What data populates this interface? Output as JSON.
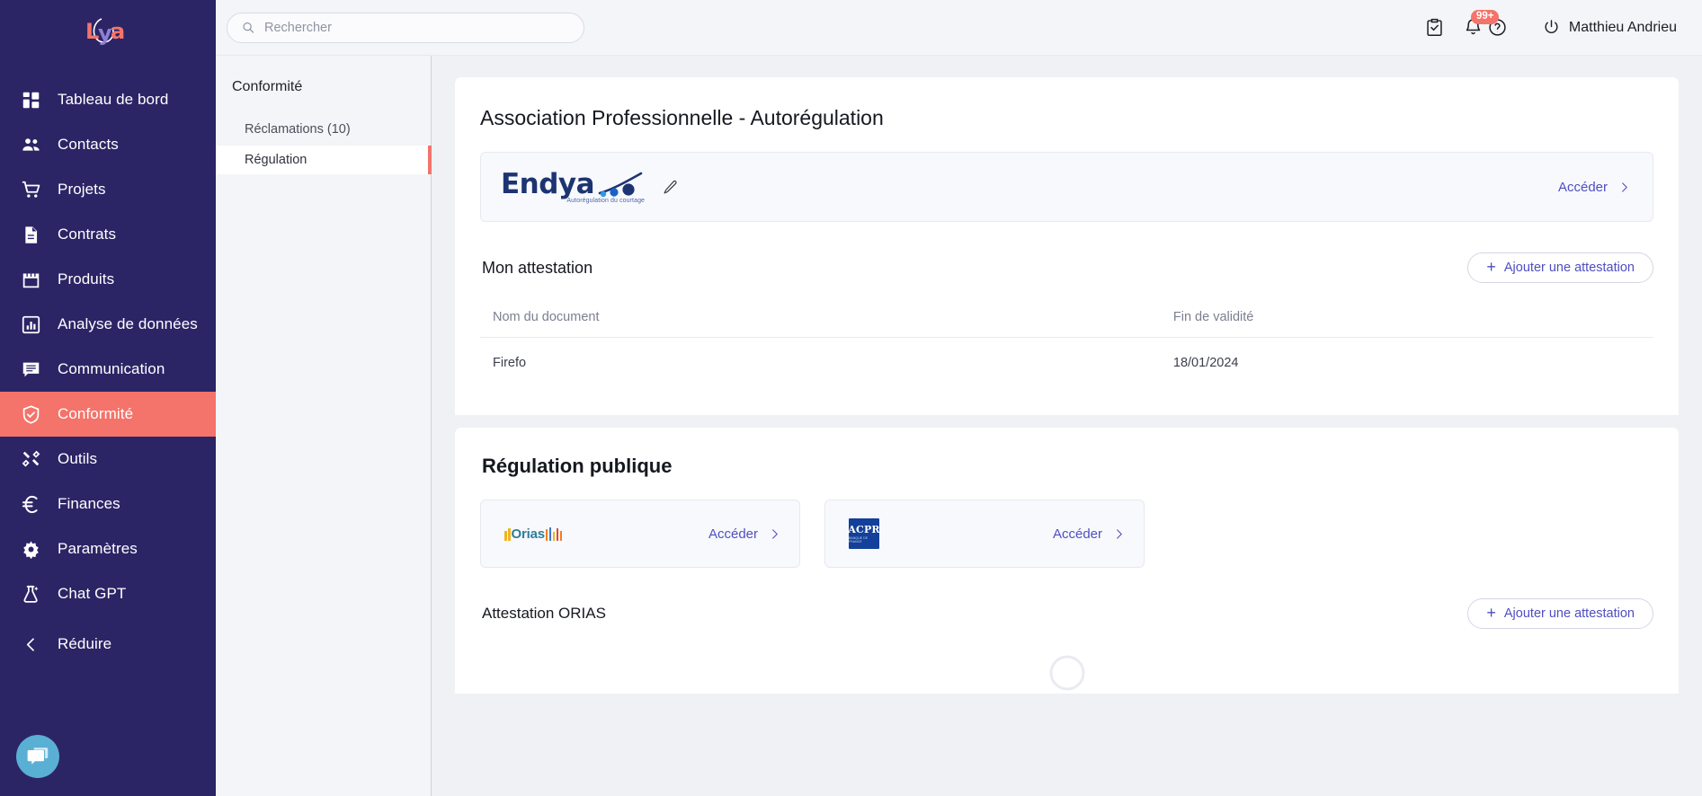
{
  "brand": {
    "logo_text": "Lya",
    "accent": "#f4736a",
    "sidebar_bg": "#2b2566",
    "link_color": "#4f4ec0"
  },
  "sidebar": {
    "items": [
      {
        "label": "Tableau de bord",
        "icon": "dashboard-icon",
        "active": false
      },
      {
        "label": "Contacts",
        "icon": "contacts-icon",
        "active": false
      },
      {
        "label": "Projets",
        "icon": "cart-icon",
        "active": false
      },
      {
        "label": "Contrats",
        "icon": "document-icon",
        "active": false
      },
      {
        "label": "Produits",
        "icon": "store-icon",
        "active": false
      },
      {
        "label": "Analyse de données",
        "icon": "bar-chart-icon",
        "active": false
      },
      {
        "label": "Communication",
        "icon": "chat-lines-icon",
        "active": false
      },
      {
        "label": "Conformité",
        "icon": "shield-check-icon",
        "active": true
      },
      {
        "label": "Outils",
        "icon": "tools-icon",
        "active": false
      },
      {
        "label": "Finances",
        "icon": "euro-icon",
        "active": false
      },
      {
        "label": "Paramètres",
        "icon": "gear-icon",
        "active": false
      },
      {
        "label": "Chat GPT",
        "icon": "flask-sparkle-icon",
        "active": false
      },
      {
        "label": "Réduire",
        "icon": "chevron-left-icon",
        "active": false
      }
    ]
  },
  "topbar": {
    "search": {
      "value": "",
      "placeholder": "Rechercher"
    },
    "tasks_icon": "clipboard-check-icon",
    "notifications": {
      "icon": "bell-icon",
      "badge": "99+"
    },
    "help_icon": "help-circle-icon",
    "user": {
      "name": "Matthieu Andrieu",
      "icon": "power-icon"
    }
  },
  "subnav": {
    "title": "Conformité",
    "items": [
      {
        "label": "Réclamations (10)",
        "active": false
      },
      {
        "label": "Régulation",
        "active": true
      }
    ]
  },
  "main": {
    "page_title": "Association Professionnelle - Autorégulation",
    "association": {
      "logo_word": "Endya",
      "logo_tagline": "Autorégulation du courtage",
      "edit_icon": "pencil-icon",
      "access_label": "Accéder",
      "access_icon": "chevron-right-icon"
    },
    "attestation": {
      "section_title": "Mon attestation",
      "add_button": {
        "label": "Ajouter une attestation",
        "icon": "plus-icon"
      },
      "columns": [
        "Nom du document",
        "Fin de validité"
      ],
      "rows": [
        {
          "document": "Firefo",
          "validity_end": "18/01/2024"
        }
      ]
    },
    "public_regulation": {
      "section_title": "Régulation publique",
      "cards": [
        {
          "logo": "orias-logo",
          "logo_text": "Orias",
          "access_label": "Accéder",
          "access_icon": "chevron-right-icon"
        },
        {
          "logo": "acpr-logo",
          "logo_text": "ACPR",
          "logo_subtext": "BANQUE DE FRANCE",
          "access_label": "Accéder",
          "access_icon": "chevron-right-icon"
        }
      ],
      "orias_attestation": {
        "section_title": "Attestation ORIAS",
        "add_button": {
          "label": "Ajouter une attestation",
          "icon": "plus-icon"
        }
      }
    }
  },
  "chat_widget": {
    "icon": "chat-bubbles-icon",
    "color": "#5aafd4"
  }
}
